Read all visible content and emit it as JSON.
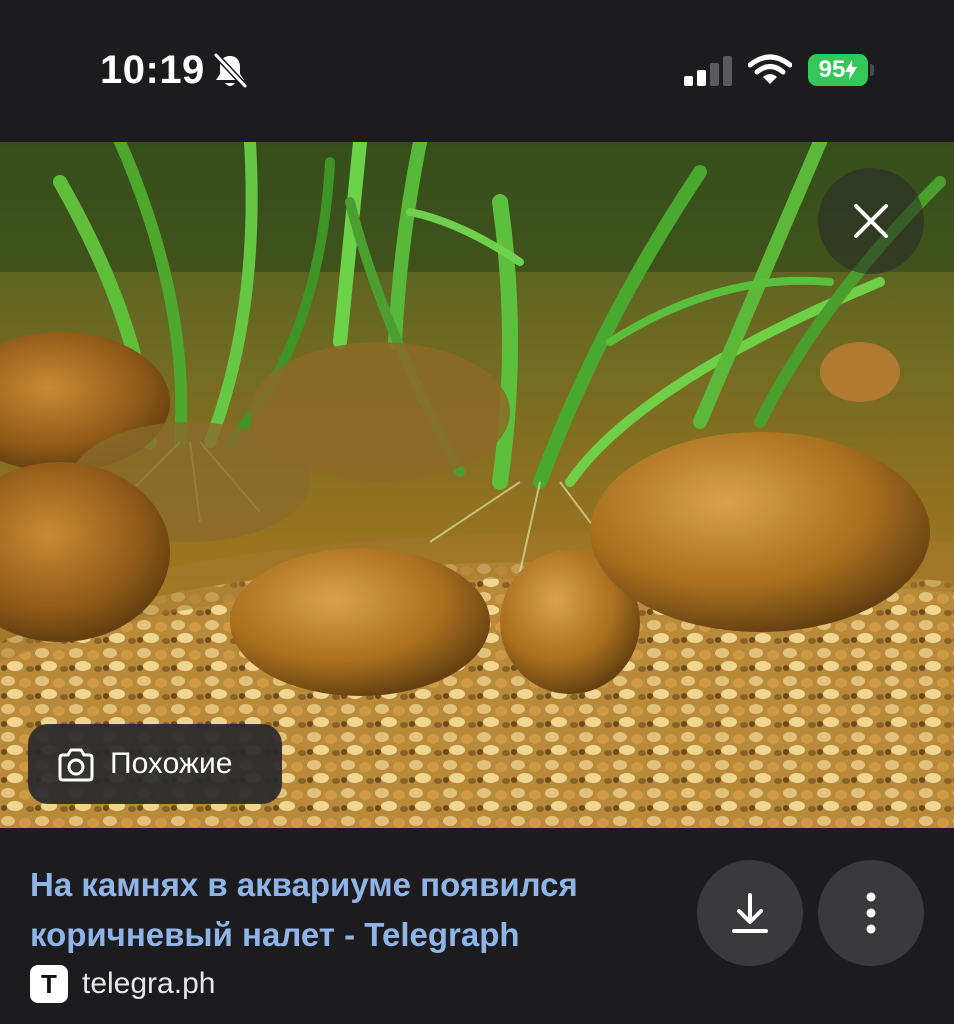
{
  "status_bar": {
    "time": "10:19",
    "battery": "95",
    "icons": [
      "bell-slash-icon",
      "cellular-signal-icon",
      "wifi-icon",
      "battery-charging-icon"
    ]
  },
  "viewer": {
    "close_icon": "close-icon",
    "similar_label": "Похожие",
    "similar_icon": "camera-lens-icon"
  },
  "caption": {
    "title": "На камнях в аквариуме появился коричневый налет - Telegraph",
    "source_logo": "T",
    "source": "telegra.ph"
  },
  "actions": {
    "download_icon": "download-icon",
    "more_icon": "more-vertical-icon"
  },
  "colors": {
    "background": "#1c1c1e",
    "link_title": "#8fb5e8",
    "battery": "#34c759",
    "round_button": "#3a3a3c"
  }
}
